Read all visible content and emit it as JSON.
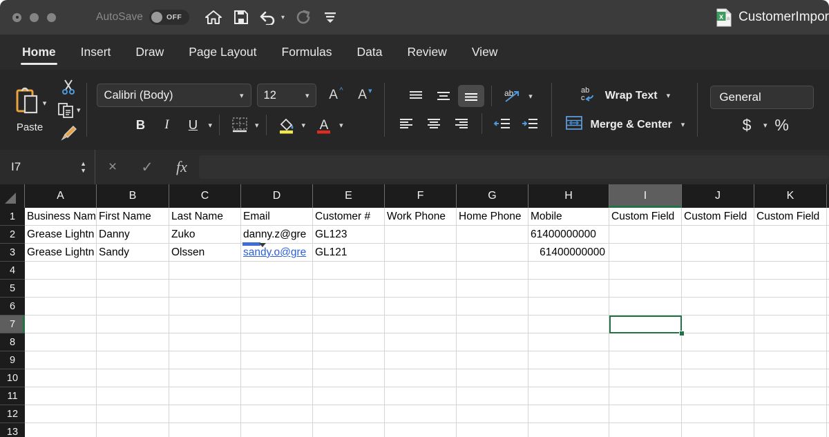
{
  "titlebar": {
    "autosave_label": "AutoSave",
    "autosave_state": "OFF",
    "document_name": "CustomerImpor",
    "quick_access": [
      {
        "name": "home-icon",
        "label": "Home"
      },
      {
        "name": "save-icon",
        "label": "Save"
      },
      {
        "name": "undo-icon",
        "label": "Undo"
      },
      {
        "name": "redo-icon",
        "label": "Redo"
      },
      {
        "name": "customize-toolbar-icon",
        "label": "Customize Toolbar"
      }
    ]
  },
  "tabs": [
    {
      "label": "Home",
      "active": true
    },
    {
      "label": "Insert",
      "active": false
    },
    {
      "label": "Draw",
      "active": false
    },
    {
      "label": "Page Layout",
      "active": false
    },
    {
      "label": "Formulas",
      "active": false
    },
    {
      "label": "Data",
      "active": false
    },
    {
      "label": "Review",
      "active": false
    },
    {
      "label": "View",
      "active": false
    }
  ],
  "ribbon": {
    "paste_label": "Paste",
    "font_name": "Calibri (Body)",
    "font_size": "12",
    "bold_label": "B",
    "italic_label": "I",
    "underline_label": "U",
    "wrap_text_label": "Wrap Text",
    "merge_center_label": "Merge & Center",
    "number_format": "General",
    "currency_label": "$",
    "percent_label": "%"
  },
  "formula_bar": {
    "name_box": "I7",
    "formula_value": "",
    "cancel_label": "×",
    "enter_label": "✓",
    "fx_label": "fx"
  },
  "grid": {
    "columns": [
      "A",
      "B",
      "C",
      "D",
      "E",
      "F",
      "G",
      "H",
      "I",
      "J",
      "K"
    ],
    "active_column": "I",
    "active_row": 7,
    "active_cell": "I7",
    "selection_color": "#217346",
    "rows": [
      {
        "num": "1",
        "cells": [
          "Business Nam",
          "First Name",
          "Last Name",
          "Email",
          "Customer #",
          "Work Phone",
          "Home Phone",
          "Mobile",
          "Custom Field",
          "Custom Field",
          "Custom Field"
        ]
      },
      {
        "num": "2",
        "cells": [
          "Grease Lightn",
          "Danny",
          "Zuko",
          "danny.z@gre",
          "GL123",
          "",
          "",
          "61400000000",
          "",
          "",
          ""
        ]
      },
      {
        "num": "3",
        "cells": [
          "Grease Lightn",
          "Sandy",
          "Olssen",
          "sandy.o@gre",
          "GL121",
          "",
          "",
          "61400000000",
          "",
          "",
          ""
        ]
      },
      {
        "num": "4",
        "cells": [
          "",
          "",
          "",
          "",
          "",
          "",
          "",
          "",
          "",
          "",
          ""
        ]
      },
      {
        "num": "5",
        "cells": [
          "",
          "",
          "",
          "",
          "",
          "",
          "",
          "",
          "",
          "",
          ""
        ]
      },
      {
        "num": "6",
        "cells": [
          "",
          "",
          "",
          "",
          "",
          "",
          "",
          "",
          "",
          "",
          ""
        ]
      },
      {
        "num": "7",
        "cells": [
          "",
          "",
          "",
          "",
          "",
          "",
          "",
          "",
          "",
          "",
          ""
        ]
      },
      {
        "num": "8",
        "cells": [
          "",
          "",
          "",
          "",
          "",
          "",
          "",
          "",
          "",
          "",
          ""
        ]
      },
      {
        "num": "9",
        "cells": [
          "",
          "",
          "",
          "",
          "",
          "",
          "",
          "",
          "",
          "",
          ""
        ]
      },
      {
        "num": "10",
        "cells": [
          "",
          "",
          "",
          "",
          "",
          "",
          "",
          "",
          "",
          "",
          ""
        ]
      },
      {
        "num": "11",
        "cells": [
          "",
          "",
          "",
          "",
          "",
          "",
          "",
          "",
          "",
          "",
          ""
        ]
      },
      {
        "num": "12",
        "cells": [
          "",
          "",
          "",
          "",
          "",
          "",
          "",
          "",
          "",
          "",
          ""
        ]
      },
      {
        "num": "13",
        "cells": [
          "",
          "",
          "",
          "",
          "",
          "",
          "",
          "",
          "",
          "",
          ""
        ]
      }
    ],
    "link_cells": [
      "2-3",
      "3-3"
    ],
    "numeric_cells": [
      "2-7",
      "3-7"
    ]
  }
}
